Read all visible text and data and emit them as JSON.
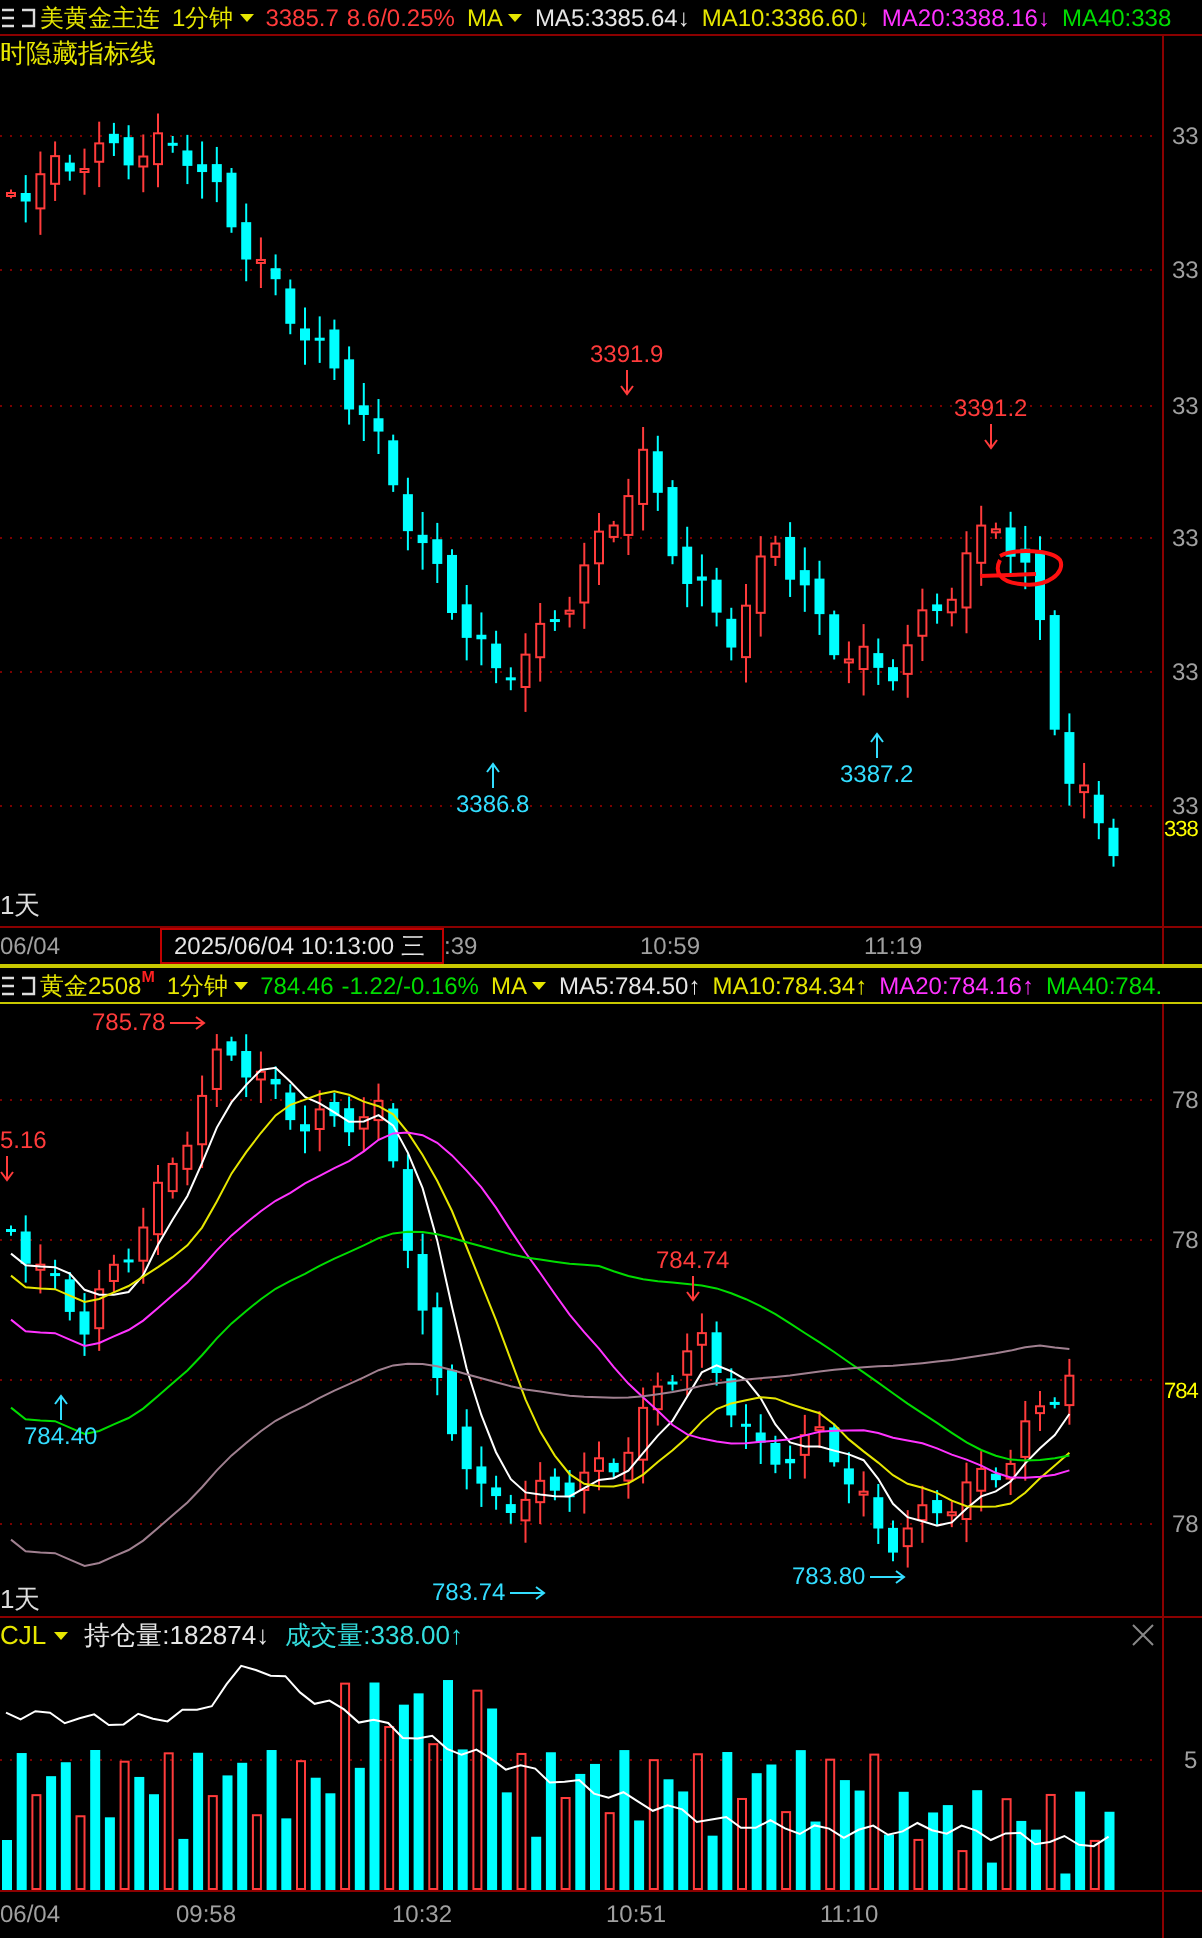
{
  "main_chart": {
    "header": {
      "symbol": "美黄金主连",
      "period": "1分钟",
      "price": "3385.7",
      "change": "8.6/0.25%",
      "indicator": "MA",
      "ma": [
        {
          "label": "MA5:3385.64↓",
          "color": "#e6e6e6"
        },
        {
          "label": "MA10:3386.60↓",
          "color": "#e6e600"
        },
        {
          "label": "MA20:3388.16↓",
          "color": "#ff33ff"
        },
        {
          "label": "MA40:338",
          "color": "#00dd00"
        }
      ]
    },
    "overlay_text": "时隐藏指标线",
    "annotations": [
      {
        "text": "3391.9",
        "kind": "peak"
      },
      {
        "text": "3391.2",
        "kind": "peak"
      },
      {
        "text": "3386.8",
        "kind": "trough"
      },
      {
        "text": "3387.2",
        "kind": "trough"
      }
    ],
    "axis_labels": [
      "33",
      "33",
      "33",
      "33",
      "33",
      "33"
    ],
    "current_price_label": "338",
    "range_label": "1天"
  },
  "time_axis_top": {
    "labels": [
      "06/04",
      ":39",
      "10:59",
      "11:19"
    ],
    "crosshair_time": "2025/06/04 10:13:00 三"
  },
  "sub_chart": {
    "header": {
      "symbol": "黄金2508",
      "symbol_badge": "M",
      "period": "1分钟",
      "price": "784.46",
      "change": "-1.22/-0.16%",
      "indicator": "MA",
      "ma": [
        {
          "label": "MA5:784.50↑",
          "color": "#e6e6e6"
        },
        {
          "label": "MA10:784.34↑",
          "color": "#e6e600"
        },
        {
          "label": "MA20:784.16↑",
          "color": "#ff33ff"
        },
        {
          "label": "MA40:784.",
          "color": "#00dd00"
        }
      ]
    },
    "annotations": [
      {
        "text": "785.78",
        "kind": "peak_side"
      },
      {
        "text": "5.16",
        "kind": "peak_edge"
      },
      {
        "text": "784.74",
        "kind": "peak"
      },
      {
        "text": "784.40",
        "kind": "trough"
      },
      {
        "text": "783.74",
        "kind": "trough_side"
      },
      {
        "text": "783.80",
        "kind": "trough_side"
      }
    ],
    "axis_labels": [
      "78",
      "78",
      "78"
    ],
    "current_price_label": "784",
    "range_label": "1天"
  },
  "volume_chart": {
    "indicator": "CJL",
    "open_interest": "持仓量:182874↓",
    "volume": "成交量:338.00↑",
    "axis_labels": [
      "5"
    ]
  },
  "time_axis_bottom": {
    "labels": [
      "06/04",
      "09:58",
      "10:32",
      "10:51",
      "11:10"
    ]
  }
}
